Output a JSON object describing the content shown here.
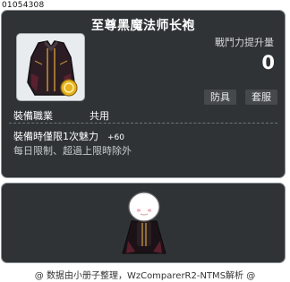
{
  "item_id": "01054308",
  "item": {
    "name": "至尊黑魔法师长袍",
    "icon": "dark-robe-icon",
    "stat_label": "戰鬥力提升量",
    "stat_value": "0",
    "category_tag": "防具",
    "set_tag": "套服",
    "job_label": "裝備職業",
    "job_value": "共用",
    "effect_text": "裝備時僅限1次魅力",
    "effect_value": "+60",
    "limit_text": "每日限制、超過上限時除外"
  },
  "preview": {
    "character": "character-preview"
  },
  "footer": "@ 数据由小册子整理，WzComparerR2-NTMS解析 @",
  "colors": {
    "panel_bg": "#2f3336",
    "panel_border": "#8a8f93",
    "tag_bg": "#45494c",
    "icon_bg": "#e9ecef"
  }
}
